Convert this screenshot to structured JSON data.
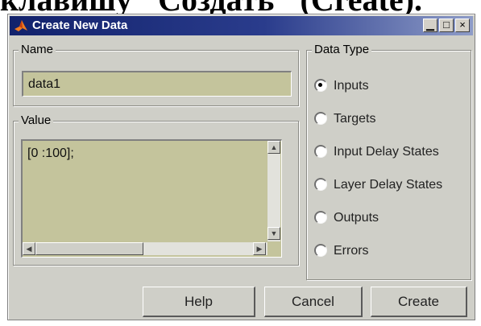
{
  "page": {
    "heading": "клавишу \"Создать\" (Create)."
  },
  "window": {
    "title": "Create New Data",
    "controls": {
      "minimize": "▁",
      "maximize": "□",
      "close": "×"
    }
  },
  "name_group": {
    "legend": "Name",
    "value": "data1"
  },
  "value_group": {
    "legend": "Value",
    "text": "[0 :100];"
  },
  "data_type": {
    "legend": "Data Type",
    "selected": "Inputs",
    "options": [
      "Inputs",
      "Targets",
      "Input Delay States",
      "Layer Delay States",
      "Outputs",
      "Errors"
    ]
  },
  "buttons": {
    "help": "Help",
    "cancel": "Cancel",
    "create": "Create"
  },
  "colors": {
    "title_bar": "#12226c",
    "field": "#c4c49c",
    "panel": "#cfcfc8"
  },
  "icons": {
    "app": "matlab-logo-icon",
    "scroll_up": "arrow-up-icon",
    "scroll_down": "arrow-down-icon",
    "scroll_left": "arrow-left-icon",
    "scroll_right": "arrow-right-icon"
  }
}
